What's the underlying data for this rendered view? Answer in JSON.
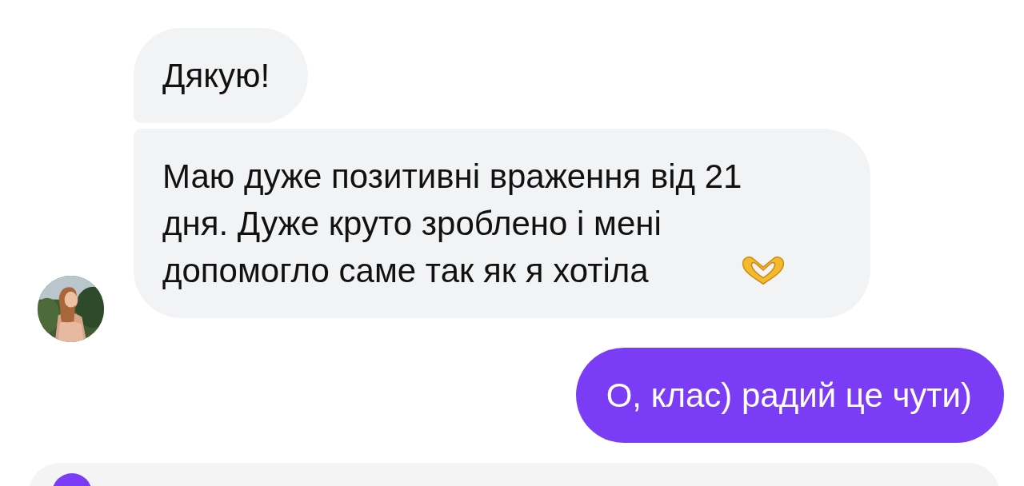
{
  "messages": [
    {
      "kind": "incoming",
      "text": "Дякую!",
      "grouped_below": true
    },
    {
      "kind": "incoming",
      "text": "Маю дуже позитивні враження від 21 дня. Дуже круто зроблено і мені допомогло саме так як я хотіла",
      "trailing_icon": true
    },
    {
      "kind": "outgoing",
      "text": "О, клас) радий це чути)"
    }
  ]
}
